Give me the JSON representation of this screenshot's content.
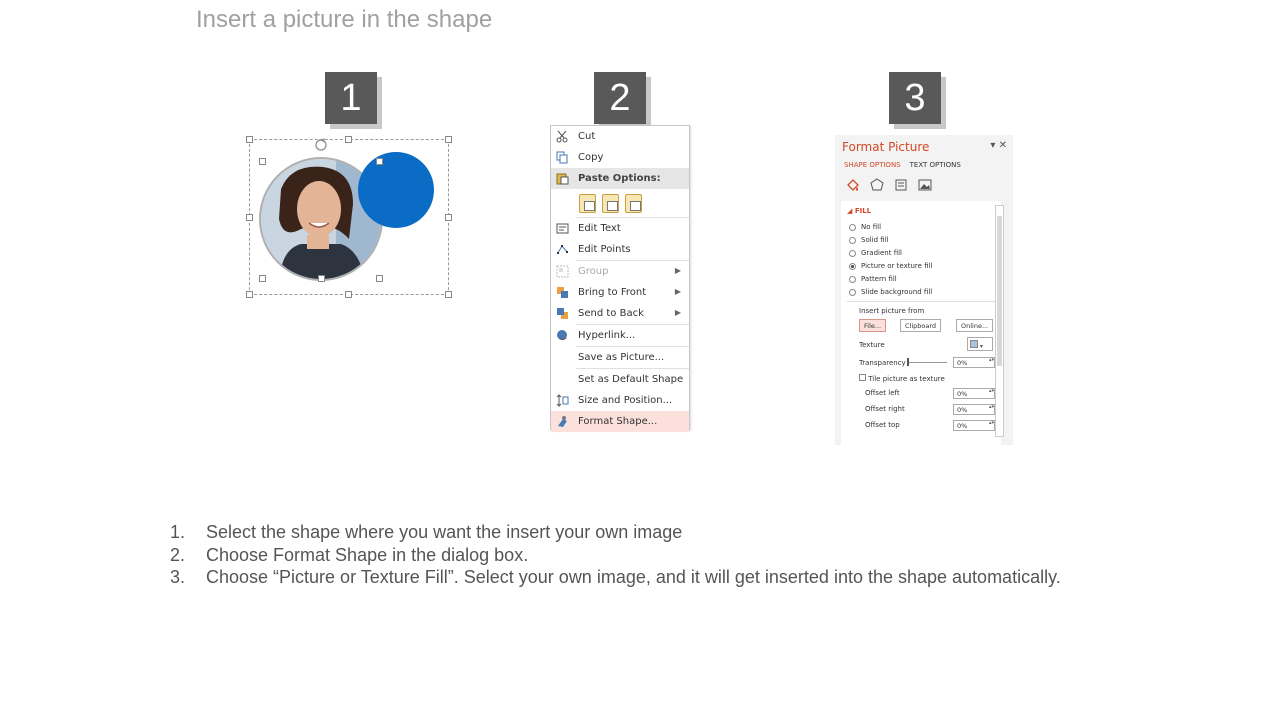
{
  "title": "Insert a picture in the shape",
  "steps": [
    "1",
    "2",
    "3"
  ],
  "context_menu": {
    "items": [
      {
        "label": "Cut",
        "icon": "scissors-icon"
      },
      {
        "label": "Copy",
        "icon": "copy-icon"
      },
      {
        "label": "Paste Options:",
        "icon": "paste-icon"
      },
      {
        "label": "Edit Text",
        "icon": "edit-text-icon"
      },
      {
        "label": "Edit Points",
        "icon": "edit-points-icon"
      },
      {
        "label": "Group",
        "icon": "group-icon"
      },
      {
        "label": "Bring to Front",
        "icon": "bring-to-front-icon"
      },
      {
        "label": "Send to Back",
        "icon": "send-to-back-icon"
      },
      {
        "label": "Hyperlink...",
        "icon": "hyperlink-icon"
      },
      {
        "label": "Save as Picture..."
      },
      {
        "label": "Set as Default Shape"
      },
      {
        "label": "Size and Position...",
        "icon": "size-position-icon"
      },
      {
        "label": "Format Shape...",
        "icon": "format-shape-icon"
      }
    ]
  },
  "format_pane": {
    "title": "Format Picture",
    "tabs": [
      "SHAPE OPTIONS",
      "TEXT OPTIONS"
    ],
    "section": "FILL",
    "fill_options": [
      "No fill",
      "Solid fill",
      "Gradient fill",
      "Picture or texture fill",
      "Pattern fill",
      "Slide background fill"
    ],
    "selected_fill": "Picture or texture fill",
    "insert_from": "Insert picture from",
    "buttons": [
      "File...",
      "Clipboard",
      "Online..."
    ],
    "texture_label": "Texture",
    "transparency_label": "Transparency",
    "transparency_value": "0%",
    "tile_label": "Tile picture as texture",
    "offsets": [
      {
        "label": "Offset left",
        "value": "0%"
      },
      {
        "label": "Offset right",
        "value": "0%"
      },
      {
        "label": "Offset top",
        "value": "0%"
      }
    ]
  },
  "instructions": [
    {
      "num": "1.",
      "text": "Select the shape where you want the insert your own image"
    },
    {
      "num": "2.",
      "text": "Choose Format Shape in the dialog box."
    },
    {
      "num": "3.",
      "text": "Choose “Picture or Texture Fill”. Select your own image, and it will get inserted into the shape automatically."
    }
  ]
}
